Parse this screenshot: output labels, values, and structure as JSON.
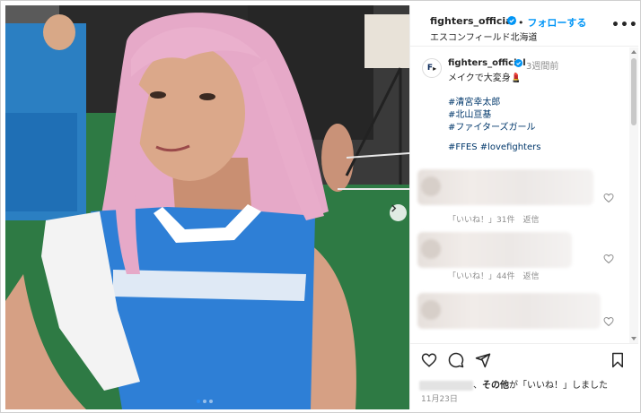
{
  "header": {
    "username": "fighters_official",
    "separator": "•",
    "follow_label": "フォローする",
    "location": "エスコンフィールド北海道",
    "more_label": "•••"
  },
  "caption": {
    "avatar_text": "F",
    "username": "fighters_official",
    "time": "3週間前",
    "text": "メイクで大変身💄",
    "hashtags": [
      "#清宮幸太郎",
      "#北山亘基",
      "#ファイターズガール"
    ],
    "tags_line": "#FFES #lovefighters"
  },
  "comments": [
    {
      "meta": "「いいね！」31件　返信"
    },
    {
      "meta": "「いいね！」44件　返信"
    },
    {
      "meta": ""
    }
  ],
  "likes": {
    "suffix_pre": "、",
    "bold": "その他",
    "suffix": "が「いいね！」しました"
  },
  "date": "11月23日",
  "carousel": {
    "current": 1,
    "total": 3
  },
  "colors": {
    "accent": "#0095f6",
    "verified": "#0095f6",
    "hashtag": "#00376b"
  },
  "icons": [
    "verified-badge-icon",
    "more-options-icon",
    "next-arrow-icon",
    "heart-icon",
    "comment-icon",
    "share-icon",
    "bookmark-icon"
  ]
}
